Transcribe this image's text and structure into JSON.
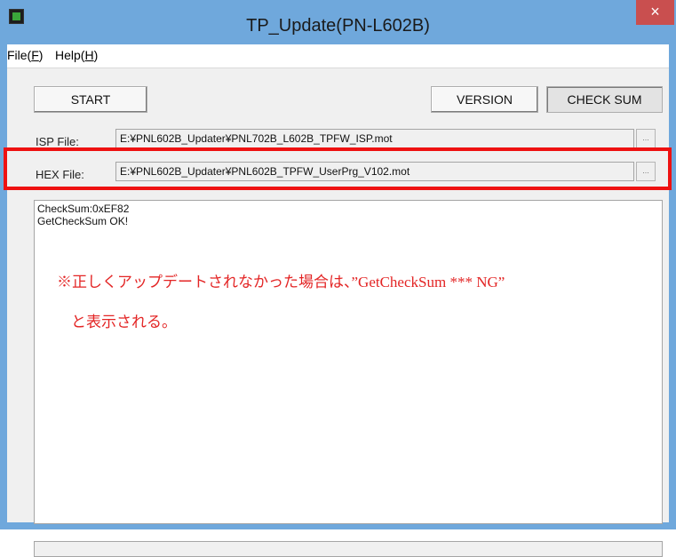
{
  "window": {
    "title": "TP_Update(PN-L602B)",
    "close_glyph": "×"
  },
  "menu": {
    "file_label": "File(",
    "file_key": "F",
    "file_tail": ")",
    "help_label": "Help(",
    "help_key": "H",
    "help_tail": ")"
  },
  "toolbar": {
    "start_label": "START",
    "version_label": "VERSION",
    "checksum_label": "CHECK SUM"
  },
  "isp": {
    "label": "ISP File:",
    "value": "E:¥PNL602B_Updater¥PNL702B_L602B_TPFW_ISP.mot",
    "browse_label": "..."
  },
  "hex": {
    "label": "HEX File:",
    "value": "E:¥PNL602B_Updater¥PNL602B_TPFW_UserPrg_V102.mot",
    "browse_label": "..."
  },
  "log": {
    "lines": [
      "CheckSum:0xEF82",
      "GetCheckSum OK!"
    ]
  },
  "annotation": {
    "line1": "※正しくアップデートされなかった場合は、”GetCheckSum *** NG”",
    "line2": "と表示される。"
  },
  "colors": {
    "titlebar": "#6fa8dc",
    "close": "#c94f4f",
    "highlight": "#ee1111",
    "annotation_text": "#e32525"
  }
}
